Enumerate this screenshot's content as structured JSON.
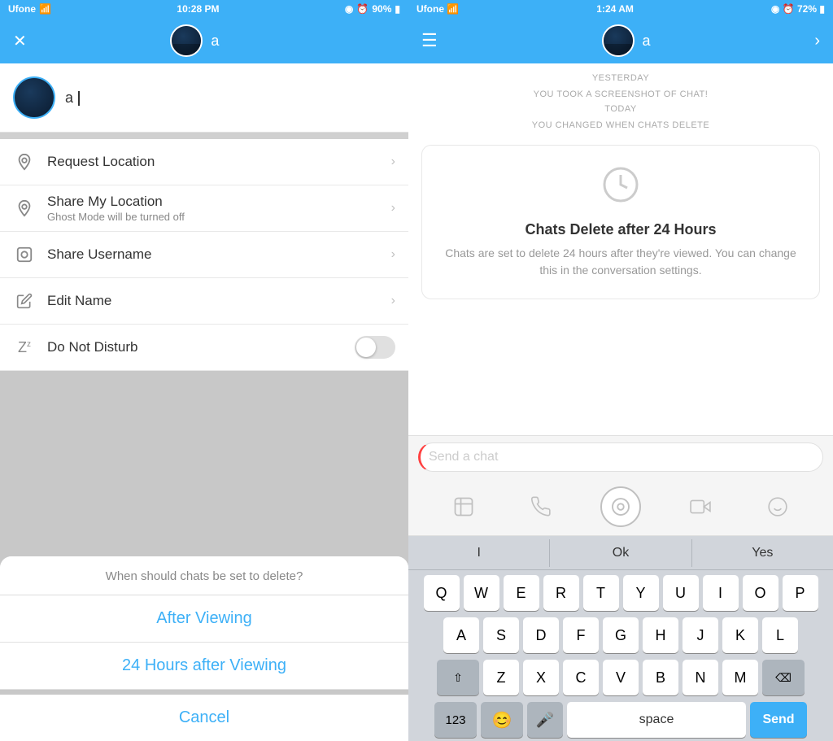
{
  "left": {
    "statusBar": {
      "carrier": "Ufone",
      "time": "10:28 PM",
      "battery": "90%"
    },
    "nav": {
      "username": "a"
    },
    "profile": {
      "name": "a"
    },
    "menuItems": [
      {
        "id": "request-location",
        "icon": "📍",
        "title": "Request Location",
        "hasChevron": true
      },
      {
        "id": "share-location",
        "icon": "📍",
        "title": "Share My Location",
        "subtitle": "Ghost Mode will be turned off",
        "hasChevron": true
      },
      {
        "id": "share-username",
        "icon": "👻",
        "title": "Share Username",
        "hasChevron": true
      },
      {
        "id": "edit-name",
        "icon": "✏️",
        "title": "Edit Name",
        "hasChevron": true
      },
      {
        "id": "do-not-disturb",
        "icon": "💤",
        "title": "Do Not Disturb",
        "hasToggle": true
      }
    ],
    "actionSheet": {
      "title": "When should chats be set to delete?",
      "options": [
        {
          "id": "after-viewing",
          "label": "After Viewing"
        },
        {
          "id": "24-hours",
          "label": "24 Hours after Viewing"
        }
      ],
      "cancelLabel": "Cancel"
    }
  },
  "right": {
    "statusBar": {
      "carrier": "Ufone",
      "time": "1:24 AM",
      "battery": "72%"
    },
    "nav": {
      "username": "a"
    },
    "chat": {
      "timestamps": [
        "YESTERDAY",
        "YOU TOOK A SCREENSHOT OF CHAT!",
        "TODAY",
        "YOU CHANGED WHEN CHATS DELETE"
      ],
      "deleteCard": {
        "title": "Chats Delete after 24 Hours",
        "description": "Chats are set to delete 24 hours after they're viewed. You can change this in the conversation settings."
      },
      "inputPlaceholder": "Send a chat"
    },
    "keyboard": {
      "suggestions": [
        "I",
        "Ok",
        "Yes"
      ],
      "rows": [
        [
          "Q",
          "W",
          "E",
          "R",
          "T",
          "Y",
          "U",
          "I",
          "O",
          "P"
        ],
        [
          "A",
          "S",
          "D",
          "F",
          "G",
          "H",
          "J",
          "K",
          "L"
        ],
        [
          "⇧",
          "Z",
          "X",
          "C",
          "V",
          "B",
          "N",
          "M",
          "⌫"
        ],
        [
          "123",
          "😊",
          "🎤",
          "space",
          "Send"
        ]
      ]
    }
  }
}
